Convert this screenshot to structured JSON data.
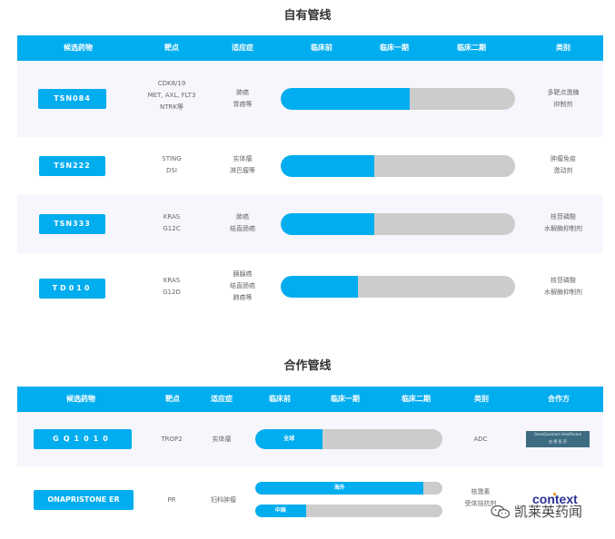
{
  "own_pipeline": {
    "title": "自有管线",
    "headers": [
      "候选药物",
      "靶点",
      "适应症",
      "临床前",
      "临床一期",
      "临床二期",
      "类别"
    ],
    "rows": [
      {
        "drug": "TSN084",
        "target": [
          "CDK8/19",
          "MET, AXL, FLT3",
          "NTRK等"
        ],
        "indication": [
          "肺癌",
          "胃癌等"
        ],
        "progress": 0.55,
        "category": [
          "多靶点激酶",
          "抑制剂"
        ]
      },
      {
        "drug": "TSN222",
        "target": [
          "STING",
          "DSI"
        ],
        "indication": [
          "实体瘤",
          "淋巴瘤等"
        ],
        "progress": 0.4,
        "category": [
          "肿瘤免疫",
          "激动剂"
        ]
      },
      {
        "drug": "TSN333",
        "target": [
          "KRAS",
          "G12C"
        ],
        "indication": [
          "肺癌",
          "结直肠癌"
        ],
        "progress": 0.4,
        "category": [
          "核苷磷酸",
          "水解酶抑制剂"
        ]
      },
      {
        "drug": "TD010",
        "target": [
          "KRAS",
          "G12D"
        ],
        "indication": [
          "胰腺癌",
          "结直肠癌",
          "肺癌等"
        ],
        "progress": 0.33,
        "category": [
          "核苷磷酸",
          "水解酶抑制剂"
        ]
      }
    ]
  },
  "coop_pipeline": {
    "title": "合作管线",
    "headers": [
      "候选药物",
      "靶点",
      "适应症",
      "临床前",
      "临床一期",
      "临床二期",
      "类别",
      "合作方"
    ],
    "rows": [
      {
        "drug": "GQ1010",
        "target": "TROP2",
        "indication": "实体瘤",
        "bars": [
          {
            "label": "全球",
            "progress": 0.36
          }
        ],
        "category": [
          "ADC"
        ],
        "partner": "GeneQuantum Healthcare",
        "partner_cn": "启 德 医 药"
      },
      {
        "drug": "ONAPRISTONE ER",
        "target": "PR",
        "indication": "妇科肿瘤",
        "bars": [
          {
            "label": "海外",
            "progress": 0.9
          },
          {
            "label": "中国",
            "progress": 0.27
          }
        ],
        "category": [
          "核激素",
          "受体拮抗剂"
        ],
        "partner": "context"
      }
    ]
  },
  "watermark": "凯莱英药闻",
  "colors": {
    "accent": "#00adef",
    "track": "#cccccc",
    "alt_row": "#f7f6fd"
  }
}
